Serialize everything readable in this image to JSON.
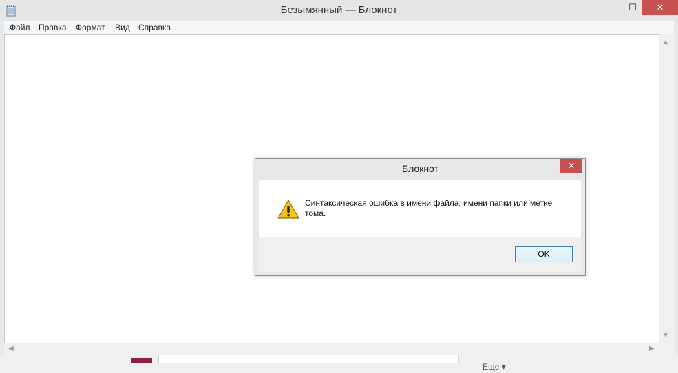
{
  "window": {
    "title": "Безымянный — Блокнот",
    "minimize_glyph": "—",
    "maximize_glyph": "☐",
    "close_glyph": "✕",
    "app_icon": "notepad-icon",
    "close_color": "#c75050"
  },
  "menu": {
    "items": [
      "Файл",
      "Правка",
      "Формат",
      "Вид",
      "Справка"
    ]
  },
  "editor": {
    "content": ""
  },
  "scrollbars": {
    "up": "▲",
    "down": "▼",
    "left": "◀",
    "right": "▶"
  },
  "background_app": {
    "more_label": "Еще ▾"
  },
  "dialog": {
    "title": "Блокнот",
    "close_glyph": "✕",
    "icon": "warning-icon",
    "message": "Синтаксическая ошибка в имени файла, имени папки или метке тома.",
    "ok_label": "OK"
  }
}
